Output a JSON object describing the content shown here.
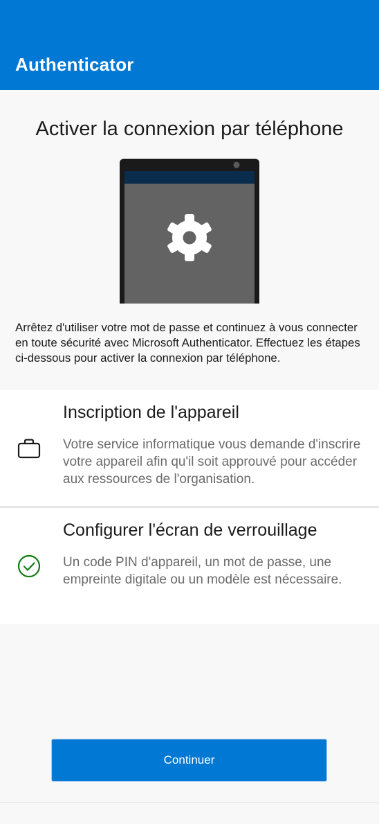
{
  "app_bar": {
    "title": "Authenticator"
  },
  "page": {
    "title": "Activer la connexion par téléphone",
    "intro": "Arrêtez d'utiliser votre mot de passe et continuez à vous connecter en toute sécurité avec Microsoft Authenticator. Effectuez les étapes ci-dessous pour activer la connexion par téléphone."
  },
  "illustration": {
    "icon": "gear-icon"
  },
  "steps": [
    {
      "icon": "briefcase-icon",
      "status": "pending",
      "title": "Inscription de l'appareil",
      "description": "Votre service informatique vous demande d'inscrire votre appareil afin qu'il soit approuvé pour accéder aux ressources de l'organisation."
    },
    {
      "icon": "check-circle-icon",
      "status": "done",
      "title": "Configurer l'écran de verrouillage",
      "description": "Un code PIN d'appareil, un mot de passe, une empreinte digitale ou un modèle est nécessaire."
    }
  ],
  "actions": {
    "continue_label": "Continuer"
  },
  "colors": {
    "accent": "#0078d4",
    "success": "#107c10",
    "phone_header": "#0a2c4d",
    "phone_screen": "#636363"
  }
}
